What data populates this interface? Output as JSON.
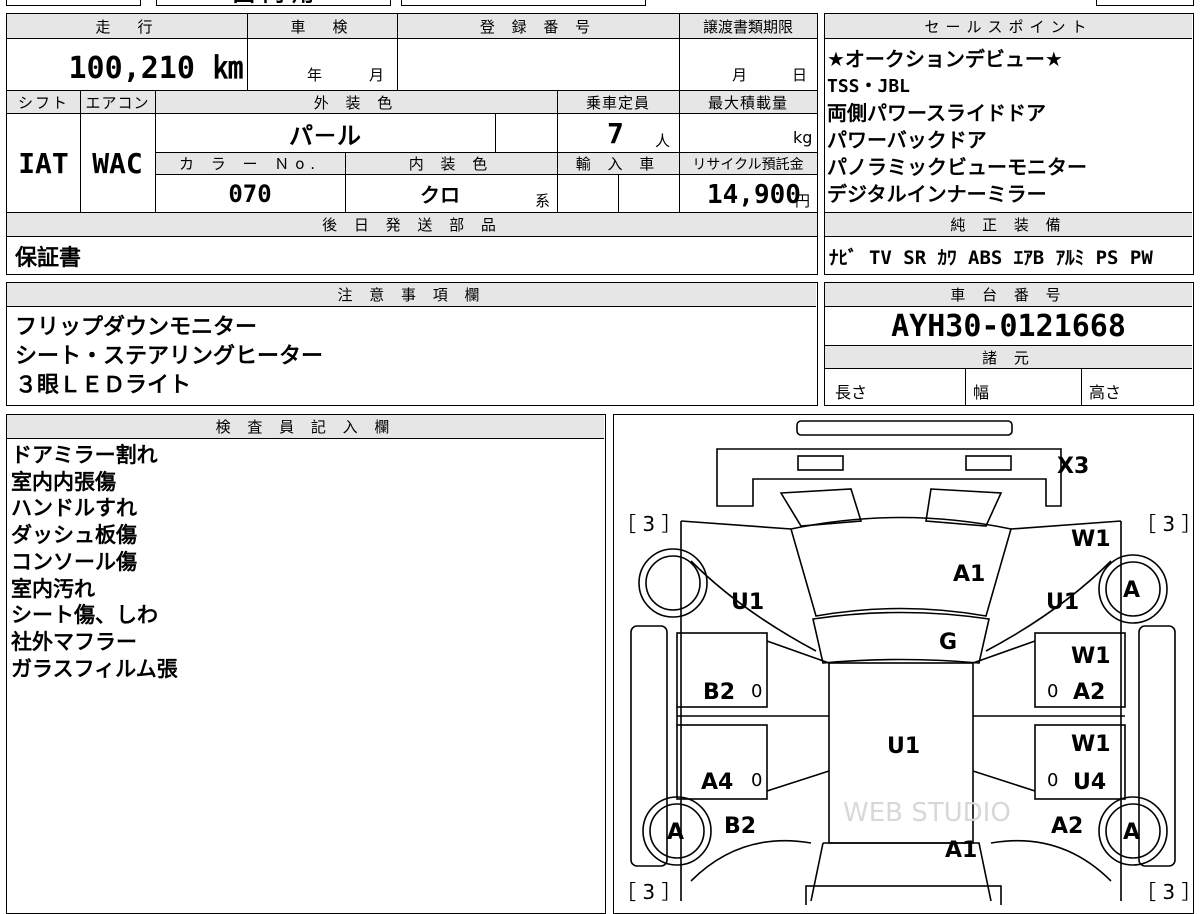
{
  "top_strip": {
    "left": "",
    "mid1": "国 内 用",
    "mid2": "",
    "right": ""
  },
  "main_info": {
    "mileage_label": "走　行",
    "mileage_value": "100,210 ㎞",
    "shaken_label": "車　検",
    "shaken_year": "年",
    "shaken_month": "月",
    "registration_label": "登 録 番 号",
    "transfer_label": "譲渡書類期限",
    "transfer_month": "月",
    "transfer_day": "日",
    "shift_label": "シフト",
    "aircon_label": "エアコン",
    "exterior_color_label": "外 装 色",
    "capacity_label": "乗車定員",
    "max_load_label": "最大積載量",
    "shift_value": "IAT",
    "aircon_value": "WAC",
    "exterior_color_value": "パ－ル",
    "capacity_value": "7",
    "capacity_unit": "人",
    "max_load_unit": "kg",
    "color_no_label": "カ ラ ー Ｎo.",
    "interior_color_label": "内 装 色",
    "import_label": "輸 入 車",
    "recycle_label": "リサイクル預託金",
    "color_no_value": "070",
    "interior_color_value": "クロ",
    "interior_color_suffix": "系",
    "recycle_value": "14,900",
    "recycle_unit": "円",
    "later_parts_label": "後 日 発 送 部 品",
    "later_parts_value": "保証書"
  },
  "sales_points": {
    "label": "セールスポイント",
    "lines": [
      "★オークションデビュー★",
      "TSS・JBL",
      "両側パワースライドドア",
      "パワーバックドア",
      "パノラミックビューモニター",
      "デジタルインナーミラー"
    ]
  },
  "genuine_equipment": {
    "label": "純 正 装 備",
    "items": "ﾅﾋﾞ TV SR ｶﾜ ABS ｴｱB ｱﾙﾐ PS PW"
  },
  "notes": {
    "label": "注 意 事 項 欄",
    "lines": [
      "フリップダウンモニター",
      "シート・ステアリングヒーター",
      "３眼ＬＥＤライト"
    ]
  },
  "chassis": {
    "label": "車 台 番 号",
    "value": "AYH30-0121668",
    "spec_label": "諸 元",
    "length_label": "長さ",
    "width_label": "幅",
    "height_label": "高さ"
  },
  "inspector": {
    "label": "検 査 員 記 入 欄",
    "lines": [
      "ドアミラー割れ",
      "室内内張傷",
      "ハンドルすれ",
      "ダッシュ板傷",
      "コンソール傷",
      "室内汚れ",
      "シート傷、しわ",
      "社外マフラー",
      "ガラスフィルム張"
    ]
  },
  "diagram": {
    "tread_tl": "［ 3 ］",
    "tread_tr": "［ 3 ］",
    "tread_bl": "［ 3 ］",
    "tread_br": "［ 3 ］",
    "x3": "X3",
    "w1_top": "W1",
    "a1_hood": "A1",
    "u1_left_front": "U1",
    "u1_right_front": "U1",
    "tire_right_front": "A",
    "g_windshield": "G",
    "w1_right_door1": "W1",
    "b2_left": "B2",
    "zero_left1": "0",
    "zero_right1": "0",
    "a2_right": "A2",
    "u1_roof": "U1",
    "w1_right_door2": "W1",
    "a4_left": "A4",
    "zero_left2": "0",
    "zero_right2": "0",
    "u4_right": "U4",
    "tire_left_rear": "A",
    "b2_left_rear": "B2",
    "a2_right_rear": "A2",
    "tire_right_rear": "A",
    "a1_rear": "A1",
    "watermark": "WEB STUDIO"
  }
}
